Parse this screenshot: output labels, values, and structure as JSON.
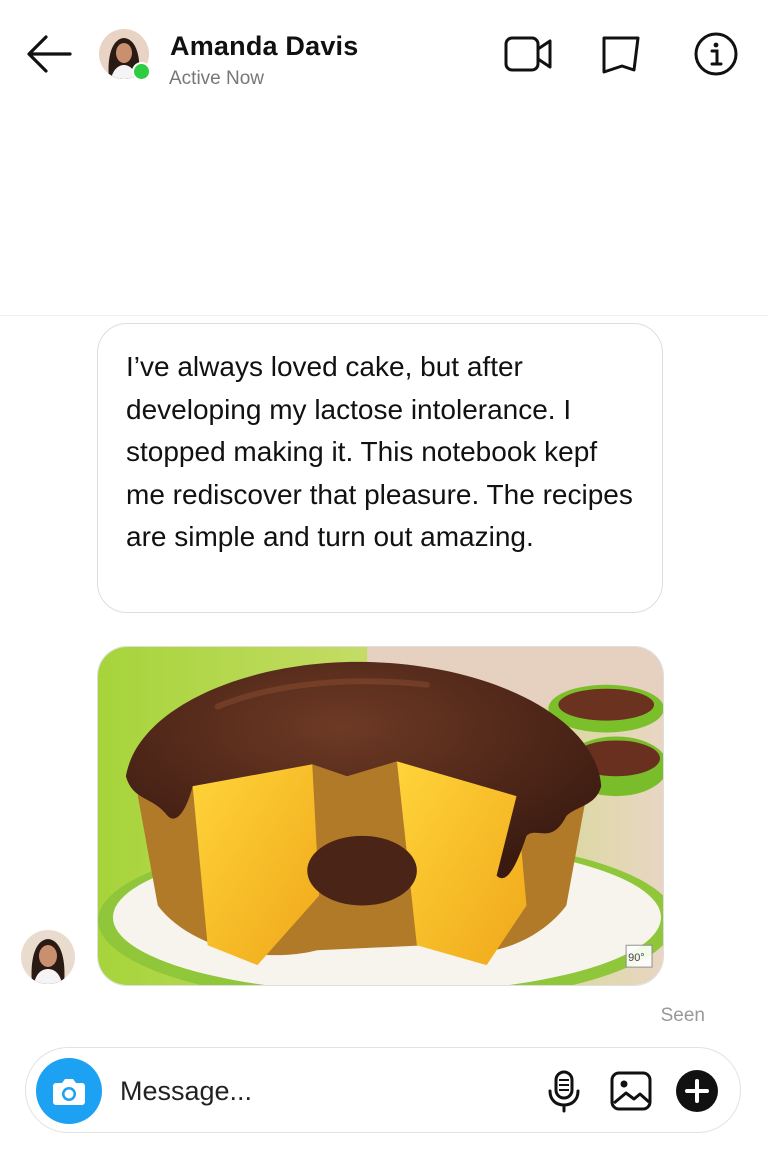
{
  "header": {
    "contact_name": "Amanda Davis",
    "status": "Active Now",
    "icons": [
      "back-arrow-icon",
      "video-call-icon",
      "bookmark-icon",
      "info-icon"
    ]
  },
  "conversation": {
    "text_message": "I’ve always loved cake, but after developing my lactose intolerance. I stopped making it. This notebook kepf me rediscover that pleasure. The recipes are simple and turn out amazing.",
    "image_message": {
      "watermark": "90°"
    },
    "seen_label": "Seen"
  },
  "composer": {
    "placeholder": "Message...",
    "icons": [
      "camera-icon",
      "microphone-icon",
      "gallery-icon",
      "plus-icon"
    ]
  },
  "colors": {
    "accent_blue": "#1da1f2",
    "online_green": "#2ecc40",
    "text_primary": "#111111",
    "text_secondary": "#777777"
  }
}
